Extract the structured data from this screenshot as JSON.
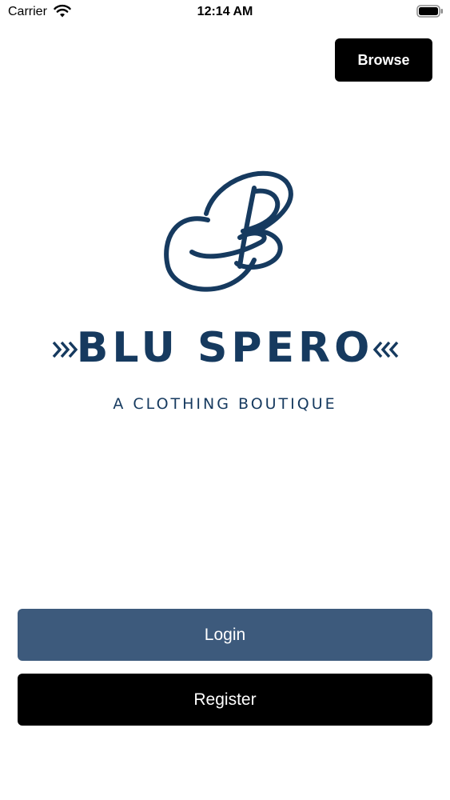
{
  "status_bar": {
    "carrier": "Carrier",
    "time": "12:14 AM"
  },
  "header": {
    "browse_label": "Browse"
  },
  "logo": {
    "brand_name": "BLU SPERO",
    "tagline": "A CLOTHING BOUTIQUE",
    "brand_color": "#163a5f",
    "monogram_icon": "script-b-monogram-icon",
    "chevron_icon": "triple-chevron-icon"
  },
  "actions": {
    "login_label": "Login",
    "register_label": "Register",
    "login_color": "#3d5a7c",
    "register_color": "#000000"
  }
}
